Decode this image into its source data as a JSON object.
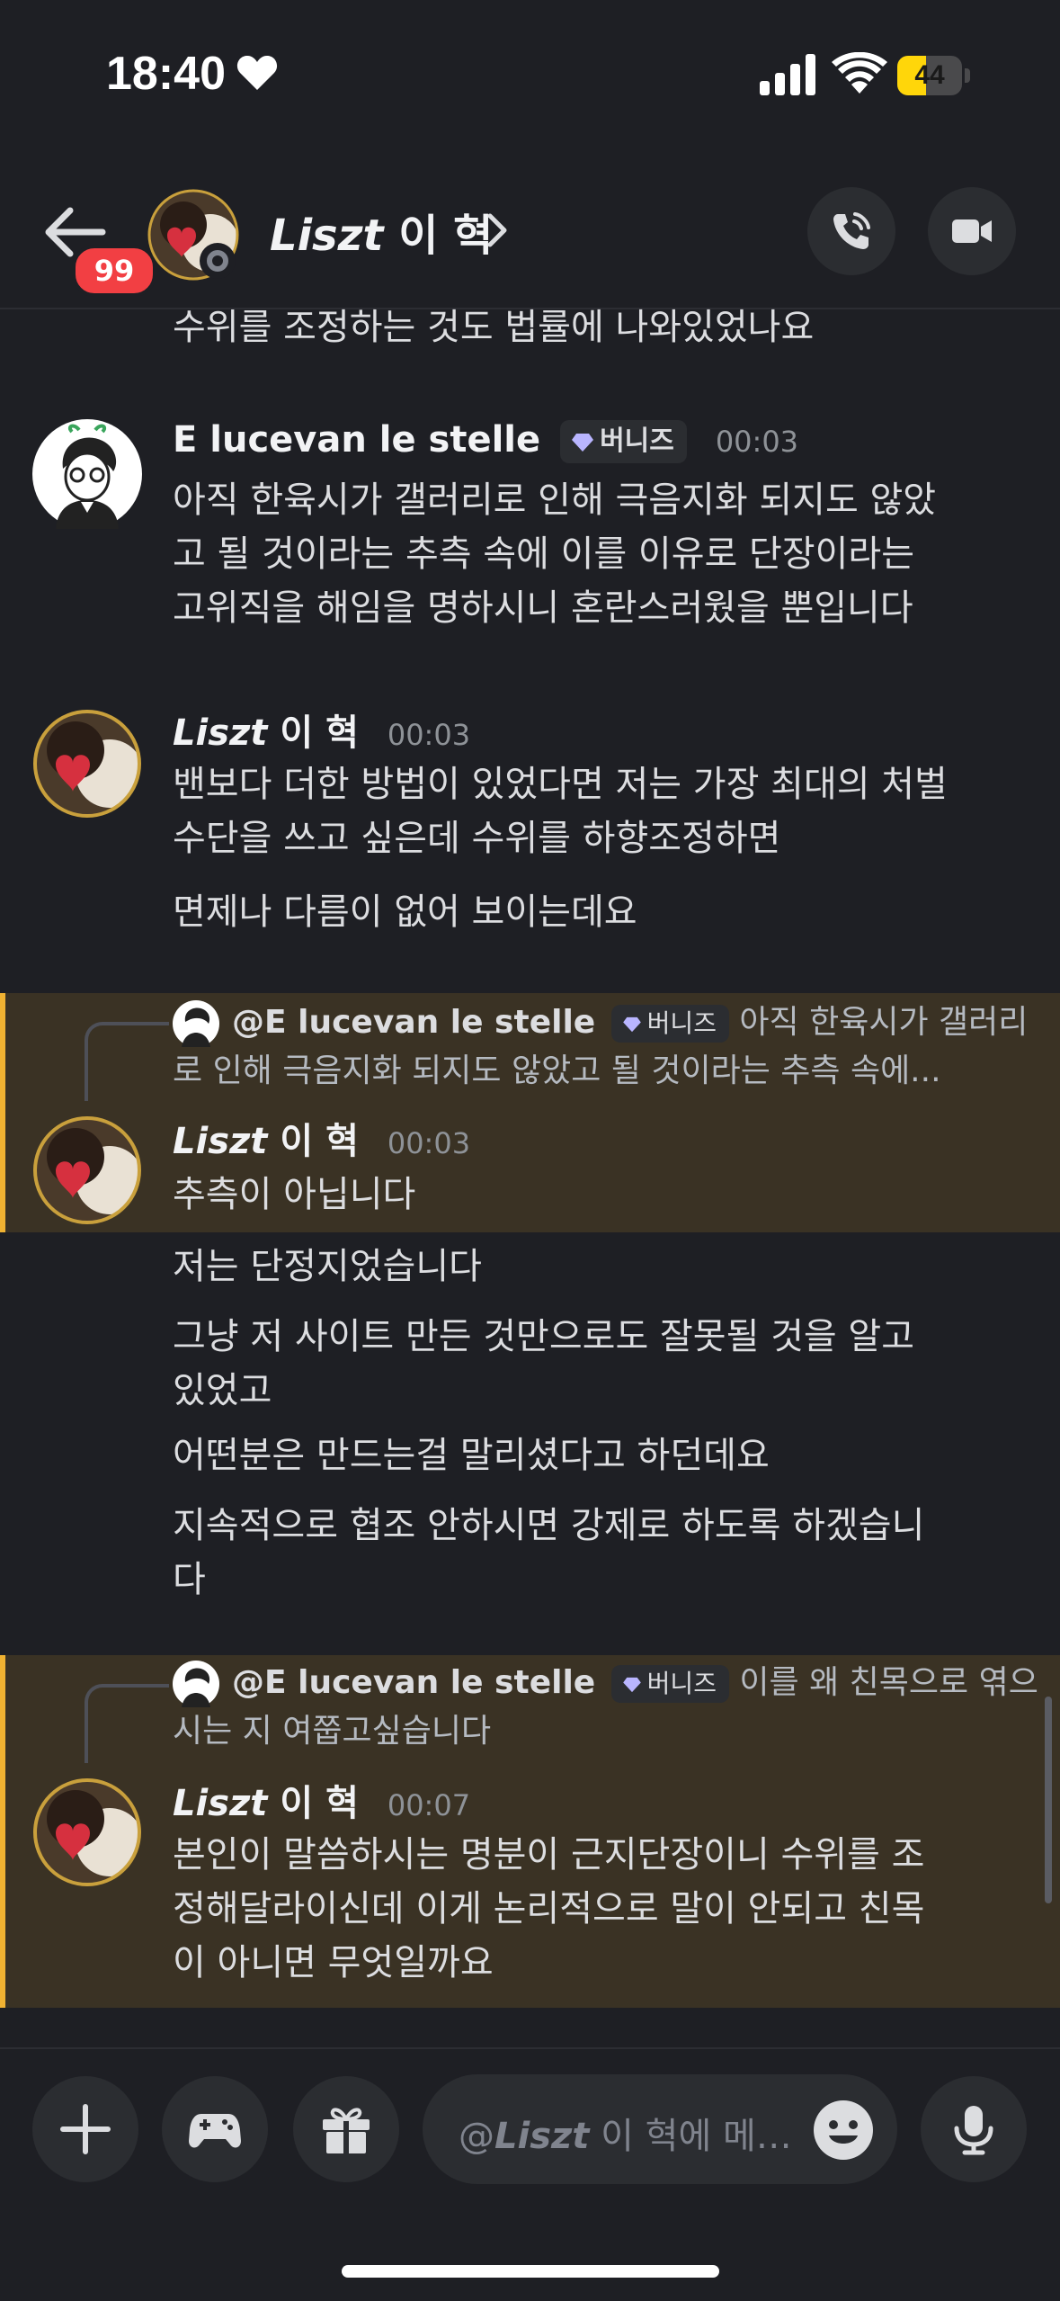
{
  "status_bar": {
    "time": "18:40",
    "battery_level": "44",
    "battery_fraction": 0.44
  },
  "header": {
    "unread_badge": "99",
    "name_latin": "Liszt",
    "name_korean": "이 혁",
    "call_icon": "phone-call-icon",
    "video_icon": "video-camera-icon"
  },
  "messages": {
    "partial_top": "수위를 조정하는 것도 법률에 나와있었나요",
    "msg1": {
      "author": "E lucevan le stelle",
      "role": "버니즈",
      "time": "00:03",
      "lines": [
        "아직 한육시가 갤러리로 인해 극음지화 되지도 않았",
        "고 될 것이라는 추측 속에 이를 이유로 단장이라는",
        "고위직을 해임을 명하시니 혼란스러웠을 뿐입니다"
      ]
    },
    "msg2": {
      "author_latin": "Liszt",
      "author_korean": "이 혁",
      "time": "00:03",
      "lines": [
        "밴보다 더한 방법이 있었다면 저는 가장 최대의 처벌",
        "수단을 쓰고 싶은데 수위를 하향조정하면"
      ],
      "followup": "면제나 다름이 없어 보이는데요"
    },
    "msg3": {
      "reply_author": "@E lucevan le stelle",
      "reply_role": "버니즈",
      "reply_line1": "아직 한육시가 갤러리",
      "reply_line2": "로 인해 극음지화 되지도 않았고 될 것이라는 추측 속에...",
      "author_latin": "Liszt",
      "author_korean": "이 혁",
      "time": "00:03",
      "text": "추측이 아닙니다",
      "followups": [
        "저는 단정지었습니다",
        "그냥 저 사이트 만든 것만으로도 잘못될 것을 알고",
        "있었고",
        "어떤분은 만드는걸 말리셨다고 하던데요",
        "지속적으로 협조 안하시면 강제로 하도록 하겠습니",
        "다"
      ]
    },
    "msg4": {
      "reply_author": "@E lucevan le stelle",
      "reply_role": "버니즈",
      "reply_line1": "이를 왜 친목으로 엮으",
      "reply_line2": "시는 지 여쭙고싶습니다",
      "author_latin": "Liszt",
      "author_korean": "이 혁",
      "time": "00:07",
      "lines": [
        "본인이 말씀하시는 명분이 근지단장이니 수위를 조",
        "정해달라이신데 이게 논리적으로 말이 안되고 친목",
        "이 아니면 무엇일까요"
      ]
    }
  },
  "composer": {
    "placeholder_prefix": "@",
    "placeholder_name": "Liszt",
    "placeholder_rest": " 이 혁에 메…"
  },
  "colors": {
    "background": "#1e1f24",
    "highlight": "#3a3224",
    "highlight_bar": "#f0b232",
    "badge": "#f23f43"
  }
}
